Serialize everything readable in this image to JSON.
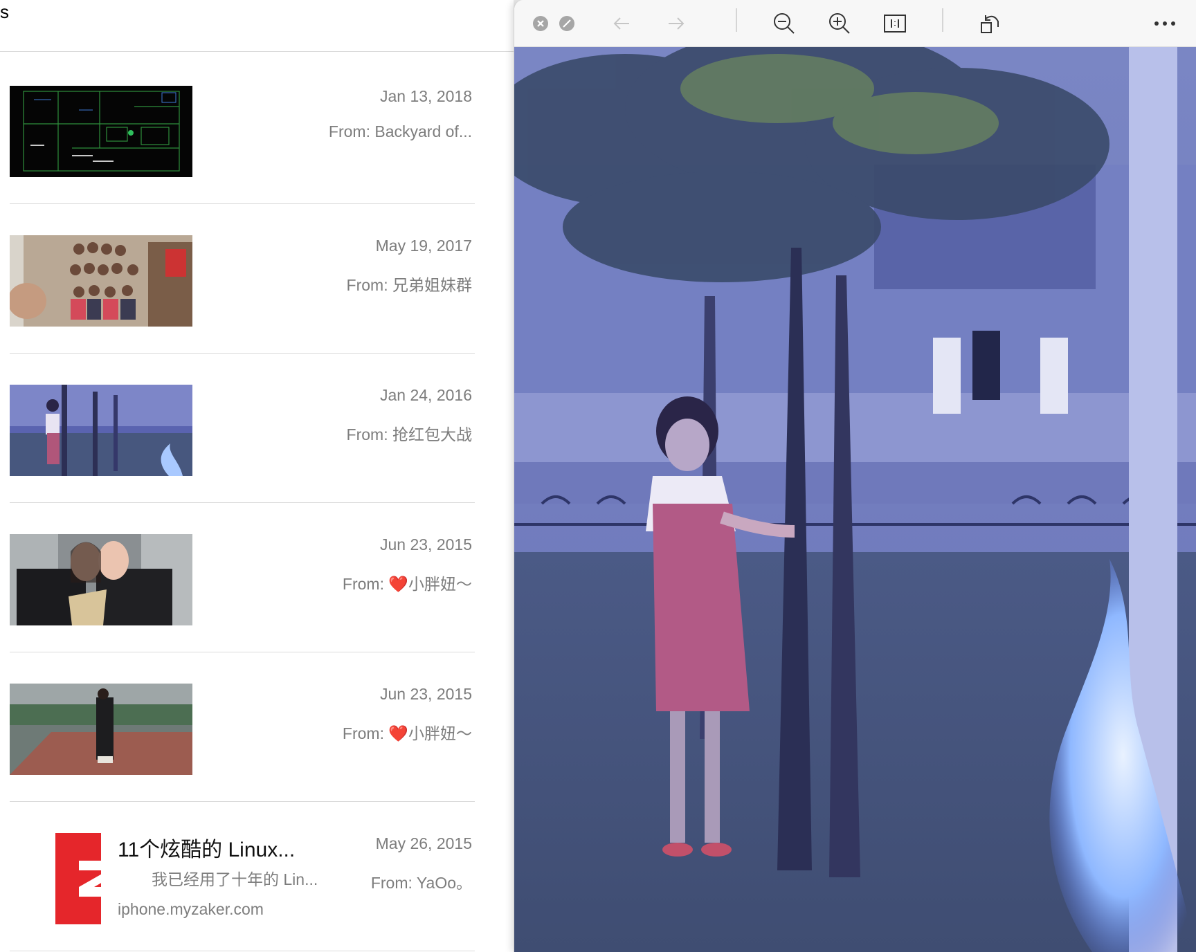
{
  "left_pane": {
    "title": "s",
    "rows": [
      {
        "date": "Jan 13, 2018",
        "from_label": "From:",
        "from_name": "Backyard  of..."
      },
      {
        "date": "May 19, 2017",
        "from_label": "From:",
        "from_name": "兄弟姐妹群"
      },
      {
        "date": "Jan 24, 2016",
        "from_label": "From:",
        "from_name": "抢红包大战"
      },
      {
        "date": "Jun 23, 2015",
        "from_label": "From:",
        "heart": "❤️",
        "from_name": "小胖妞～"
      },
      {
        "date": "Jun 23, 2015",
        "from_label": "From:",
        "heart": "❤️",
        "from_name": "小胖妞～"
      }
    ],
    "link_row": {
      "title": "11个炫酷的 Linux...",
      "snippet": "我已经用了十年的 Lin...",
      "domain": "iphone.myzaker.com",
      "date": "May 26, 2015",
      "from_label": "From:",
      "from_name": "YaOo。",
      "app_color": "#e5262b"
    }
  },
  "viewer": {
    "toolbar_icons": [
      "close-icon",
      "minimize-icon",
      "back-arrow-icon",
      "forward-arrow-icon",
      "zoom-out-icon",
      "zoom-in-icon",
      "actual-size-icon",
      "rotate-icon",
      "more-icon"
    ],
    "photo_tint": "#4c56a6"
  }
}
